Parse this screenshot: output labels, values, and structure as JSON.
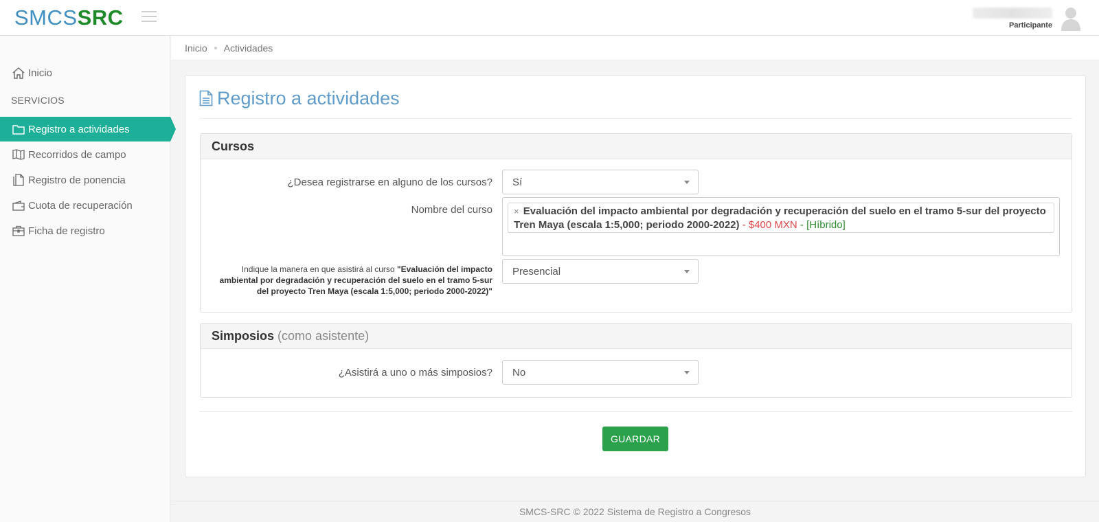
{
  "header": {
    "logo_part1": "SMCS",
    "logo_part2": "SRC",
    "user_role": "Participante"
  },
  "sidebar": {
    "home_label": "Inicio",
    "section_label": "SERVICIOS",
    "items": [
      {
        "label": "Registro a actividades",
        "icon": "folder-icon",
        "active": true
      },
      {
        "label": "Recorridos de campo",
        "icon": "map-icon",
        "active": false
      },
      {
        "label": "Registro de ponencia",
        "icon": "document-icon",
        "active": false
      },
      {
        "label": "Cuota de recuperación",
        "icon": "wallet-icon",
        "active": false
      },
      {
        "label": "Ficha de registro",
        "icon": "briefcase-icon",
        "active": false
      }
    ]
  },
  "breadcrumb": {
    "items": [
      "Inicio",
      "Actividades"
    ]
  },
  "page": {
    "title": "Registro a actividades"
  },
  "courses": {
    "heading": "Cursos",
    "register_question": "¿Desea registrarse en alguno de los cursos?",
    "register_value": "Sí",
    "course_name_label": "Nombre del curso",
    "selected_course": {
      "remove": "×",
      "name": "Evaluación del impacto ambiental por degradación y recuperación del suelo en el tramo 5-sur del proyecto Tren Maya (escala 1:5,000; periodo 2000-2022)",
      "sep1": " - ",
      "price": "$400 MXN",
      "sep2": " - ",
      "mode": "[Híbrido]"
    },
    "attendance_prefix": "Indique la manera en que asistirá al curso ",
    "attendance_course": "\"Evaluación del impacto ambiental por degradación y recuperación del suelo en el tramo 5-sur del proyecto Tren Maya (escala 1:5,000; periodo 2000-2022)\"",
    "attendance_value": "Presencial"
  },
  "symposia": {
    "heading": "Simposios",
    "heading_sub": "(como asistente)",
    "question": "¿Asistirá a uno o más simposios?",
    "value": "No"
  },
  "actions": {
    "save_label": "GUARDAR"
  },
  "footer": {
    "text": "SMCS-SRC © 2022 Sistema de Registro a Congresos"
  },
  "colors": {
    "accent": "#1eaf99",
    "title": "#5f9cc9",
    "save": "#2ba14b",
    "price": "#e0464a",
    "mode": "#2e8b2e"
  }
}
